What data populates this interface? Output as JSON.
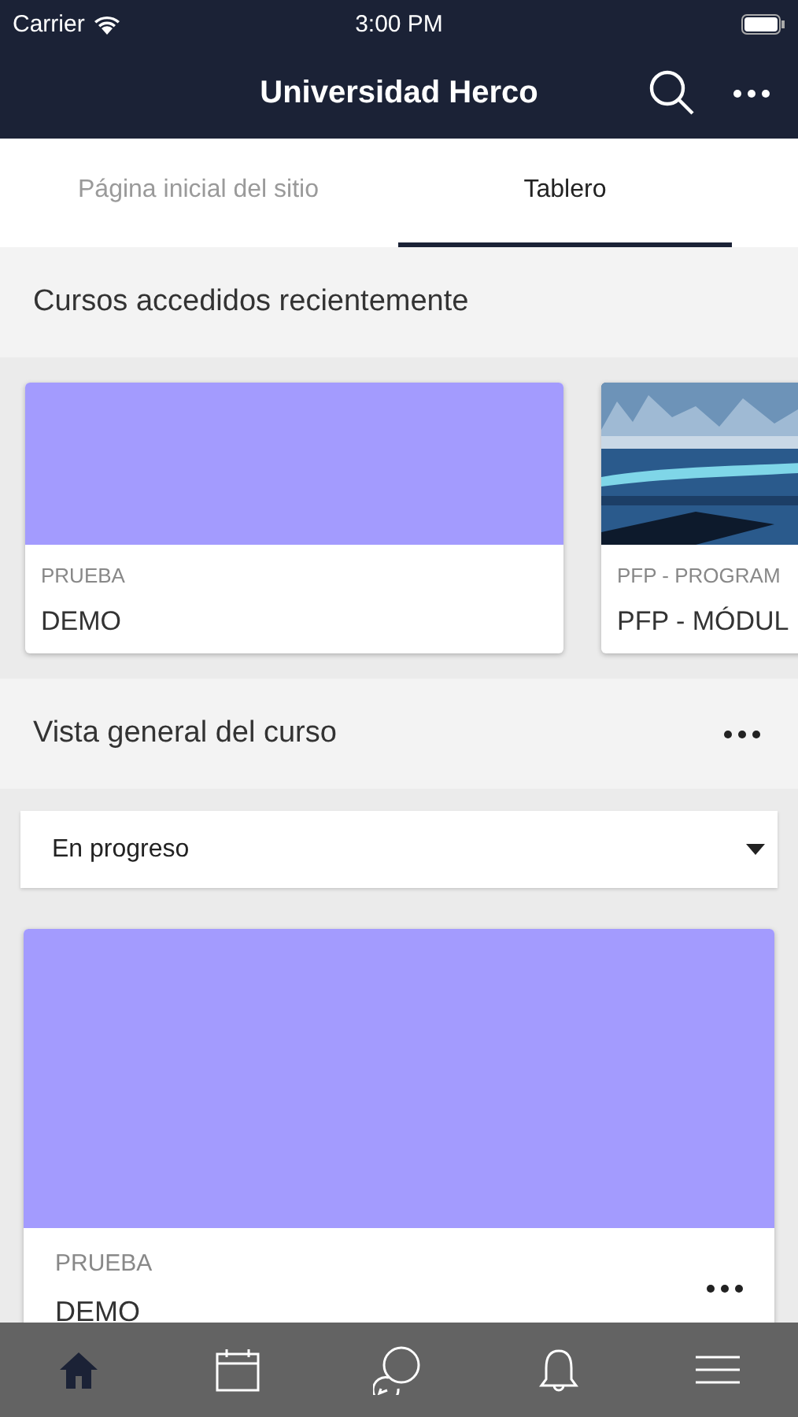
{
  "status_bar": {
    "carrier": "Carrier",
    "time": "3:00 PM"
  },
  "nav_bar": {
    "title": "Universidad Herco"
  },
  "tabs": [
    {
      "label": "Página inicial del sitio",
      "selected": false
    },
    {
      "label": "Tablero",
      "selected": true
    }
  ],
  "recent_courses": {
    "title": "Cursos accedidos recientemente",
    "cards": [
      {
        "kind": "color",
        "category": "PRUEBA",
        "name": "DEMO"
      },
      {
        "kind": "picture",
        "category": "PFP - PROGRAM",
        "name": "PFP - MÓDUL"
      }
    ]
  },
  "course_overview": {
    "title": "Vista general del curso",
    "filter": {
      "value": "En progreso"
    },
    "cards": [
      {
        "kind": "color",
        "category": "PRUEBA",
        "name": "DEMO"
      }
    ]
  },
  "tab_bar": [
    {
      "kind": "home",
      "selected": true
    },
    {
      "kind": "calendar",
      "selected": false
    },
    {
      "kind": "chat",
      "selected": false
    },
    {
      "kind": "bell",
      "selected": false
    },
    {
      "kind": "menu",
      "selected": false
    }
  ]
}
